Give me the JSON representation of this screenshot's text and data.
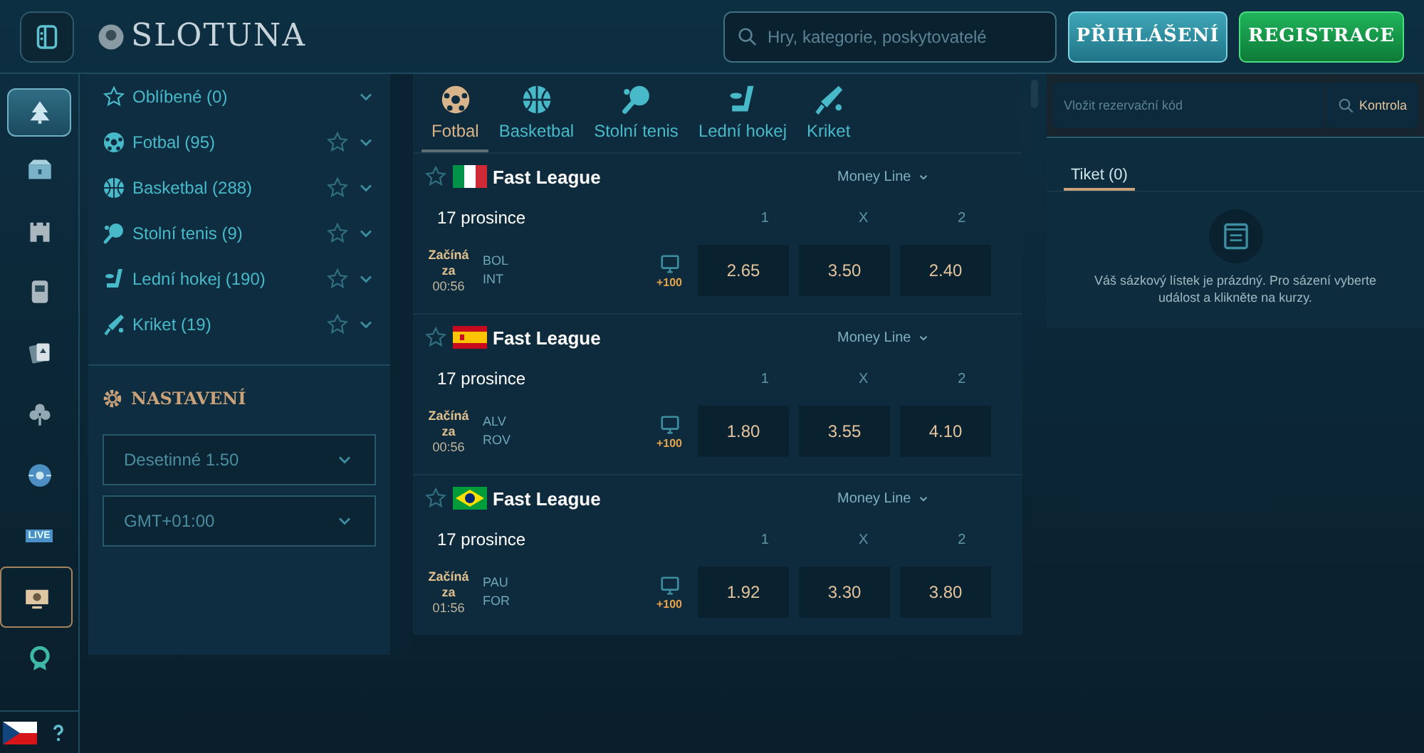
{
  "header": {
    "logo": "SLOTUNA",
    "search": {
      "placeholder": "Hry, kategorie, poskytovatelé"
    },
    "buttons": [
      {
        "label": "PŘIHLÁŠENÍ",
        "kind": "login"
      },
      {
        "label": "REGISTRACE",
        "kind": "register"
      }
    ]
  },
  "rail": {
    "items": [
      {
        "kind": "tree",
        "selected": false,
        "active": true
      },
      {
        "kind": "chest",
        "selected": false,
        "active": false
      },
      {
        "kind": "castle",
        "selected": false,
        "active": false
      },
      {
        "kind": "slot",
        "selected": false,
        "active": false
      },
      {
        "kind": "cards",
        "selected": false,
        "active": false
      },
      {
        "kind": "clover",
        "selected": false,
        "active": false
      },
      {
        "kind": "ball",
        "selected": false,
        "active": false
      },
      {
        "kind": "live",
        "label": "LIVE",
        "selected": false,
        "active": false
      },
      {
        "kind": "monitor",
        "selected": true,
        "active": false
      },
      {
        "kind": "award",
        "selected": false,
        "active": false
      }
    ]
  },
  "sports_menu": {
    "items": [
      {
        "kind": "star",
        "label": "Oblíbené (0)",
        "favoritable": false
      },
      {
        "kind": "football",
        "label": "Fotbal (95)",
        "favoritable": true
      },
      {
        "kind": "basketball",
        "label": "Basketbal (288)",
        "favoritable": true
      },
      {
        "kind": "tabletennis",
        "label": "Stolní tenis (9)",
        "favoritable": true
      },
      {
        "kind": "hockey",
        "label": "Lední hokej (190)",
        "favoritable": true
      },
      {
        "kind": "cricket",
        "label": "Kriket (19)",
        "favoritable": true
      }
    ],
    "settings": {
      "title": "NASTAVENÍ",
      "selects": [
        {
          "value": "Desetinné 1.50"
        },
        {
          "value": "GMT+01:00"
        }
      ]
    }
  },
  "sport_tabs": [
    {
      "kind": "football",
      "label": "Fotbal",
      "selected": true
    },
    {
      "kind": "basketball",
      "label": "Basketbal",
      "selected": false
    },
    {
      "kind": "tabletennis",
      "label": "Stolní tenis",
      "selected": false
    },
    {
      "kind": "hockey",
      "label": "Lední hokej",
      "selected": false
    },
    {
      "kind": "cricket",
      "label": "Kriket",
      "selected": false
    }
  ],
  "leagues": [
    {
      "kind": "italy",
      "name": "Fast League",
      "market": "Money Line",
      "date": "17 prosince",
      "columns": [
        "1",
        "X",
        "2"
      ],
      "match": {
        "status": [
          "Začíná",
          "za",
          "00:56"
        ],
        "teams": [
          "BOL",
          "INT"
        ],
        "extra": "+100",
        "odds": [
          "2.65",
          "3.50",
          "2.40"
        ]
      }
    },
    {
      "kind": "spain",
      "name": "Fast League",
      "market": "Money Line",
      "date": "17 prosince",
      "columns": [
        "1",
        "X",
        "2"
      ],
      "match": {
        "status": [
          "Začíná",
          "za",
          "00:56"
        ],
        "teams": [
          "ALV",
          "ROV"
        ],
        "extra": "+100",
        "odds": [
          "1.80",
          "3.55",
          "4.10"
        ]
      }
    },
    {
      "kind": "brazil",
      "name": "Fast League",
      "market": "Money Line",
      "date": "17 prosince",
      "columns": [
        "1",
        "X",
        "2"
      ],
      "match": {
        "status": [
          "Začíná",
          "za",
          "01:56"
        ],
        "teams": [
          "PAU",
          "FOR"
        ],
        "extra": "+100",
        "odds": [
          "1.92",
          "3.30",
          "3.80"
        ]
      }
    }
  ],
  "betslip": {
    "code": {
      "placeholder": "Vložit rezervační kód"
    },
    "check_button": "Kontrola",
    "tabs": [
      {
        "label": "Tiket (0)",
        "selected": true
      }
    ],
    "empty_message": "Váš sázkový lístek je prázdný. Pro sázení vyberte událost a klikněte na kurzy."
  }
}
